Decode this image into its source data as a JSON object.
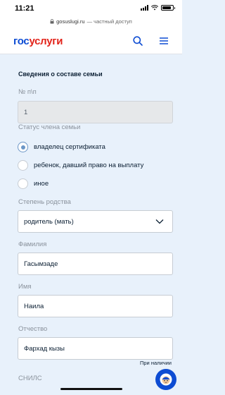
{
  "status_bar": {
    "time": "11:21"
  },
  "browser": {
    "url_host": "gosuslugi.ru",
    "url_suffix": "— частный доступ"
  },
  "header": {
    "logo_part1": "гос",
    "logo_part2": "услуги"
  },
  "form": {
    "section_title": "Сведения о составе семьи",
    "number_label": "№ п\\п",
    "number_value": "1",
    "status_label": "Статус члена семьи",
    "status_options": [
      {
        "label": "владелец сертификата",
        "selected": true
      },
      {
        "label": "ребенок, давший право на выплату",
        "selected": false
      },
      {
        "label": "иное",
        "selected": false
      }
    ],
    "kinship_label": "Степень родства",
    "kinship_value": "родитель (мать)",
    "surname_label": "Фамилия",
    "surname_value": "Гасымзаде",
    "name_label": "Имя",
    "name_value": "Наила",
    "patronymic_label": "Отчество",
    "patronymic_value": "Фархад кызы",
    "patronymic_hint": "При наличии",
    "snils_label": "СНИЛС"
  },
  "colors": {
    "brand_blue": "#0d4cd3",
    "brand_red": "#e2231a",
    "background": "#e8f1fb"
  }
}
